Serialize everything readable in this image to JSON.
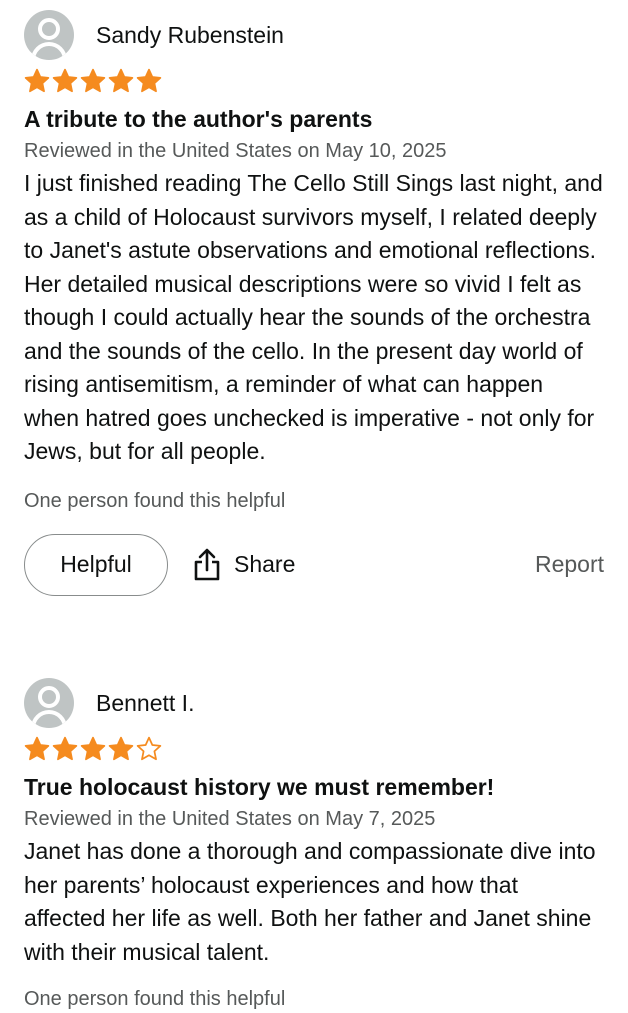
{
  "colors": {
    "star": "#f58b1f",
    "text": "#0f1111",
    "muted": "#565959",
    "avatar": "#bfc4c4"
  },
  "reviews": [
    {
      "reviewer": "Sandy Rubenstein",
      "rating": 5,
      "title": "A tribute to the author's parents",
      "meta": "Reviewed in the United States on May 10, 2025",
      "body": "I just finished reading The Cello Still Sings last night, and as a child of Holocaust survivors myself, I related deeply to Janet's astute observations and emotional reflections. Her detailed musical descriptions were so vivid I felt as though I could actually hear the sounds of the orchestra and the sounds of the cello. In the present day world of rising antisemitism, a reminder of what can happen when hatred goes unchecked is imperative - not only for Jews, but for all people.",
      "helpful_count": "One person found this helpful",
      "helpful_label": "Helpful",
      "share_label": "Share",
      "report_label": "Report"
    },
    {
      "reviewer": "Bennett I.",
      "rating": 4,
      "title": "True holocaust history we must remember!",
      "meta": "Reviewed in the United States on May 7, 2025",
      "body": "Janet has done a thorough and compassionate dive into her parents’ holocaust experiences and how that affected her life as well. Both her father and Janet shine with their musical talent.",
      "helpful_count": "One person found this helpful"
    }
  ]
}
